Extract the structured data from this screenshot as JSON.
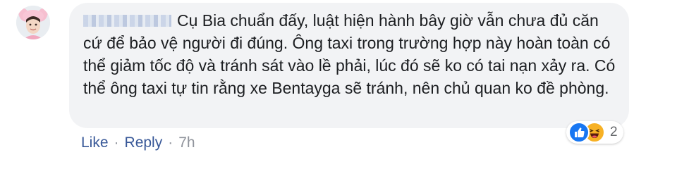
{
  "comment": {
    "text": "Cụ Bia chuẩn đấy, luật hiện hành bây giờ vẫn chưa đủ căn cứ để bảo vệ người đi đúng. Ông taxi trong trường hợp này hoàn toàn có thể giảm tốc độ và tránh sát vào lề phải, lúc đó sẽ ko có tai nạn xảy ra. Có thể ông taxi tự tin rằng xe Bentayga sẽ tránh, nên chủ quan ko đề phòng."
  },
  "reactions": {
    "icons": [
      "like-icon",
      "haha-icon"
    ],
    "count": "2"
  },
  "actions": {
    "like_label": "Like",
    "separator": "·",
    "reply_label": "Reply",
    "timestamp": "7h"
  },
  "colors": {
    "bubble": "#f2f3f5",
    "link": "#385898",
    "meta": "#90949c",
    "like_blue": "#1877f2",
    "haha_yellow": "#f7b125"
  }
}
